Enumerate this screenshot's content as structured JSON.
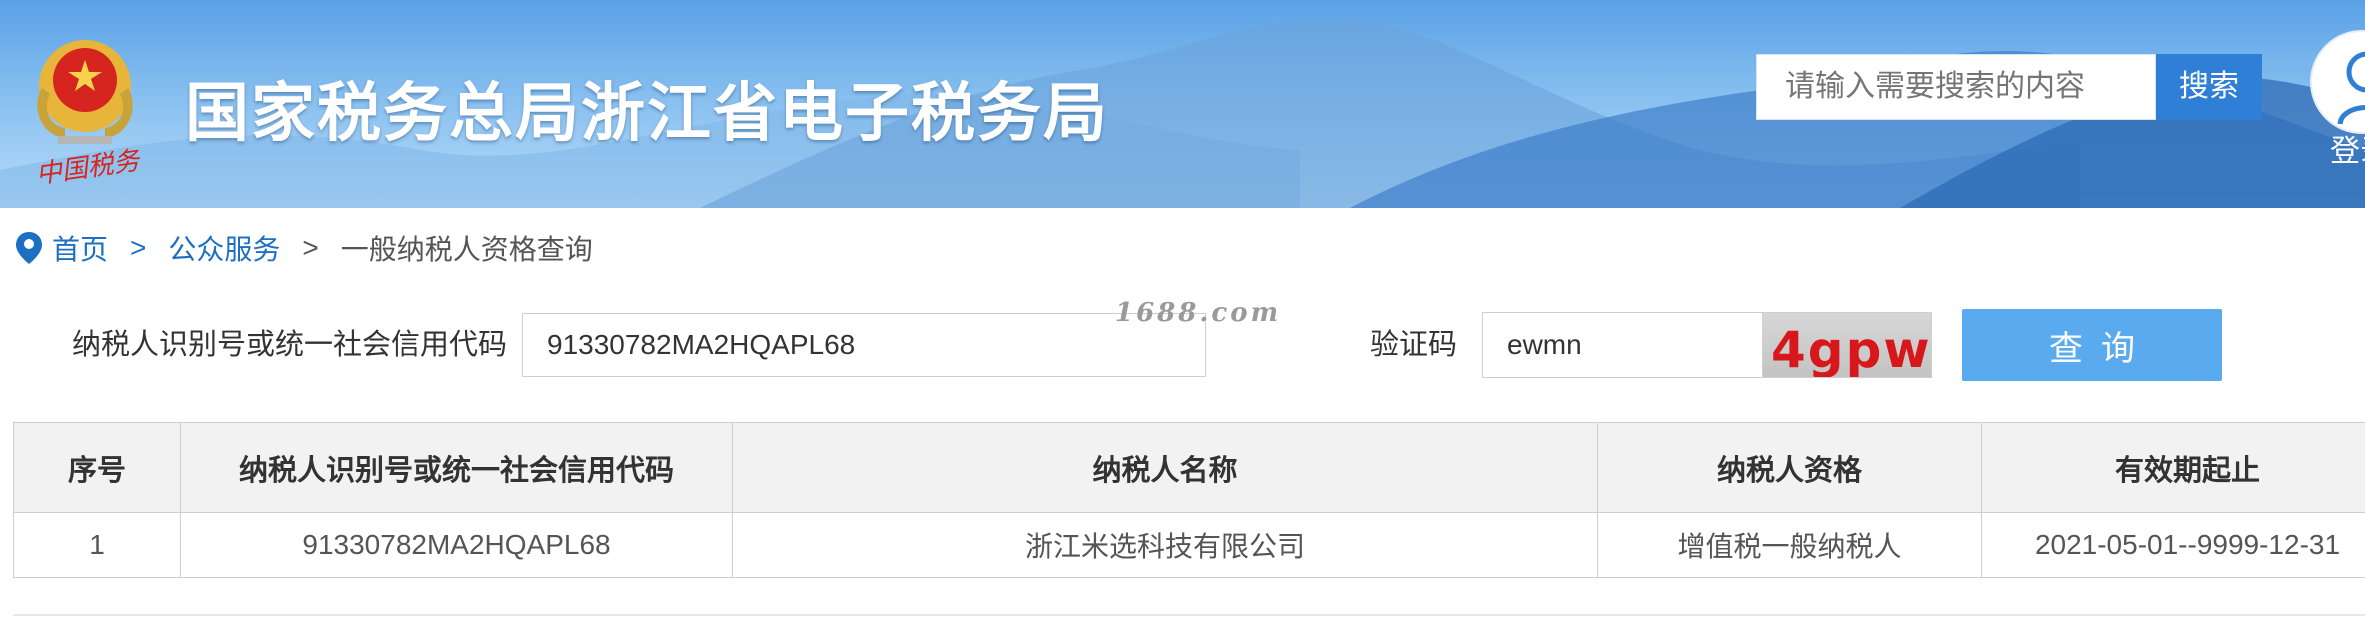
{
  "header": {
    "title": "国家税务总局浙江省电子税务局",
    "search_placeholder": "请输入需要搜索的内容",
    "search_button": "搜索",
    "login_label": "登录"
  },
  "breadcrumb": {
    "home": "首页",
    "separator": ">",
    "section": "公众服务",
    "current": "一般纳税人资格查询"
  },
  "form": {
    "taxpayer_id_label": "纳税人识别号或统一社会信用代码",
    "taxpayer_id_value": "91330782MA2HQAPL68",
    "captcha_label": "验证码",
    "captcha_value": "ewmn",
    "captcha_image_text": "4gpw",
    "query_button": "查询"
  },
  "watermark": "1688.com",
  "table": {
    "headers": [
      "序号",
      "纳税人识别号或统一社会信用代码",
      "纳税人名称",
      "纳税人资格",
      "有效期起止"
    ],
    "rows": [
      [
        "1",
        "91330782MA2HQAPL68",
        "浙江米选科技有限公司",
        "增值税一般纳税人",
        "2021-05-01--9999-12-31"
      ]
    ]
  },
  "colors": {
    "link_blue": "#1d6fc4",
    "search_button": "#2f7fd6",
    "query_button": "#5aaaf0",
    "captcha_text": "#d8171a"
  }
}
